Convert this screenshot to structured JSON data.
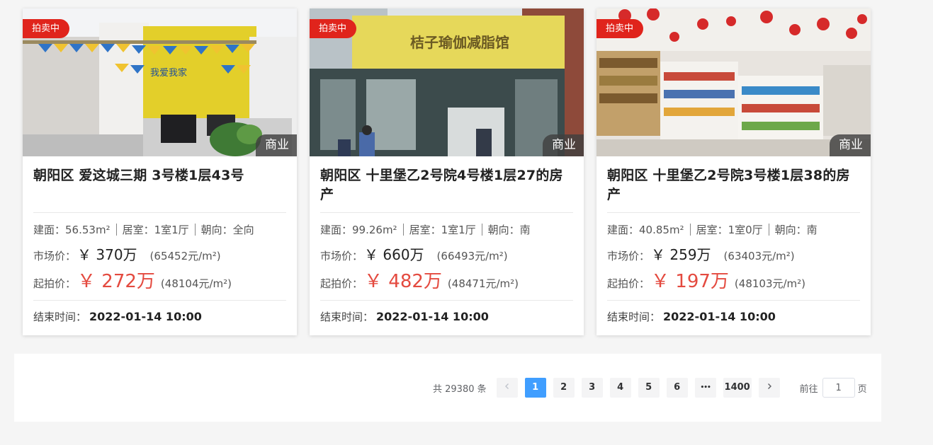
{
  "listings": [
    {
      "status": "拍卖中",
      "category": "商业",
      "title": "朝阳区 爱这城三期 3号楼1层43号",
      "area": "建面：56.53m²",
      "rooms": "居室：1室1厅",
      "facing": "朝向：全向",
      "market_label": "市场价：",
      "market_price": "￥ 370万",
      "market_unit": "(65452元/m²)",
      "start_label": "起拍价：",
      "start_price": "￥ 272万",
      "start_unit": "(48104元/m²)",
      "end_label": "结束时间：",
      "end_time": "2022-01-14 10:00",
      "photo_scene": "office-with-yellow-wall-and-flags"
    },
    {
      "status": "拍卖中",
      "category": "商业",
      "title": "朝阳区 十里堡乙2号院4号楼1层27的房产",
      "area": "建面：99.26m²",
      "rooms": "居室：1室1厅",
      "facing": "朝向：南",
      "market_label": "市场价：",
      "market_price": "￥ 660万",
      "market_unit": "(66493元/m²)",
      "start_label": "起拍价：",
      "start_price": "￥ 482万",
      "start_unit": "(48471元/m²)",
      "end_label": "结束时间：",
      "end_time": "2022-01-14 10:00",
      "photo_scene": "yoga-shop-storefront",
      "photo_sign": "桔子瑜伽减脂馆"
    },
    {
      "status": "拍卖中",
      "category": "商业",
      "title": "朝阳区 十里堡乙2号院3号楼1层38的房产",
      "area": "建面：40.85m²",
      "rooms": "居室：1室0厅",
      "facing": "朝向：南",
      "market_label": "市场价：",
      "market_price": "￥ 259万",
      "market_unit": "(63403元/m²)",
      "start_label": "起拍价：",
      "start_price": "￥ 197万",
      "start_unit": "(48103元/m²)",
      "end_label": "结束时间：",
      "end_time": "2022-01-14 10:00",
      "photo_scene": "convenience-store-interior"
    }
  ],
  "pagination": {
    "total": "共 29380 条",
    "prev_icon": "chevron-left-icon",
    "next_icon": "chevron-right-icon",
    "pages": [
      "1",
      "2",
      "3",
      "4",
      "5",
      "6"
    ],
    "current_page": "1",
    "ellipsis": "•••",
    "last_page": "1400",
    "goto_label": "前往",
    "goto_value": "1",
    "page_suffix": "页",
    "active_color": "#409eff"
  },
  "colors": {
    "status_badge": "#e0241c",
    "start_price": "#e44a3f"
  }
}
